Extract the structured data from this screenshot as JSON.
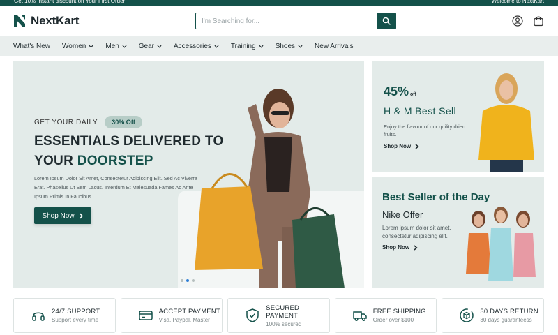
{
  "topbar": {
    "left_text": "Get 10% Instant discount on Your First Order",
    "right_text": "Welcome to NextKart"
  },
  "header": {
    "logo_text": "NextKart",
    "search_placeholder": "I'm Searching for..."
  },
  "nav": {
    "items": [
      {
        "label": "What's New",
        "dropdown": false
      },
      {
        "label": "Women",
        "dropdown": true
      },
      {
        "label": "Men",
        "dropdown": true
      },
      {
        "label": "Gear",
        "dropdown": true
      },
      {
        "label": "Accessories",
        "dropdown": true
      },
      {
        "label": "Training",
        "dropdown": true
      },
      {
        "label": "Shoes",
        "dropdown": true
      },
      {
        "label": "New Arrivals",
        "dropdown": false
      }
    ]
  },
  "hero": {
    "subtitle": "GET YOUR DAILY",
    "badge": "30% Off",
    "title_line1": "ESSENTIALS DELIVERED TO",
    "title_line2_plain": "YOUR ",
    "title_line2_accent": "DOORSTEP",
    "description": "Lorem Ipsum Dolor Sit Amet, Consectetur Adipiscing Elit. Sed Ac Viverra Erat. Phasellus Ut Sem Lacus. Interdum Et Malesuada Fames Ac Ante Ipsum Primis In Faucibus.",
    "button": "Shop Now",
    "slides": 3,
    "active_slide": 2
  },
  "promo1": {
    "percent": "45%",
    "percent_suffix": "off",
    "title": "H & M Best Sell",
    "description": "Enjoy the flavour of our quility dried fruits.",
    "link": "Shop Now"
  },
  "promo2": {
    "title": "Best Seller of the Day",
    "subtitle": "Nike Offer",
    "description": "Lorem ipsum dolor sit amet, consectetur adipiscing elit.",
    "link": "Shop Now"
  },
  "features": [
    {
      "icon": "headphones-icon",
      "title": "24/7 SUPPORT",
      "subtitle": "Support every time"
    },
    {
      "icon": "credit-card-icon",
      "title": "ACCEPT PAYMENT",
      "subtitle": "Visa, Paypal, Master"
    },
    {
      "icon": "shield-check-icon",
      "title": "SECURED PAYMENT",
      "subtitle": "100% secured"
    },
    {
      "icon": "truck-icon",
      "title": "FREE SHIPPING",
      "subtitle": "Order over $100"
    },
    {
      "icon": "return-box-icon",
      "title": "30 DAYS RETURN",
      "subtitle": "30 days guaranteess"
    }
  ],
  "colors": {
    "brand": "#14514a",
    "panel": "#e3ebe9",
    "nav_bg": "#e9eeed"
  }
}
